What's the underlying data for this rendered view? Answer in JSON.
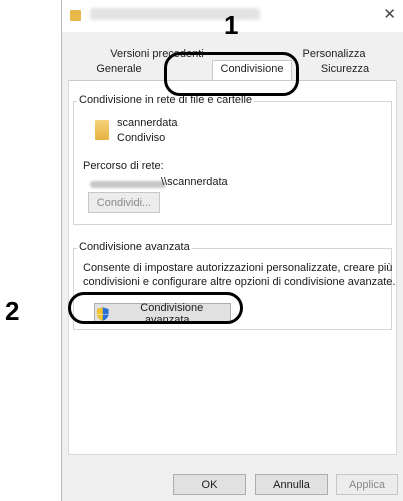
{
  "tabs": {
    "row1": [
      "Versioni precedenti",
      "Personalizza"
    ],
    "row2": [
      "Generale",
      "Condivisione",
      "Sicurezza"
    ]
  },
  "network_sharing": {
    "title": "Condivisione in rete di file e cartelle",
    "folder_name": "scannerdata",
    "status": "Condiviso",
    "path_label": "Percorso di rete:",
    "path_value": "\\\\scannerdata",
    "share_button": "Condividi..."
  },
  "advanced_sharing": {
    "title": "Condivisione avanzata",
    "description_line1": "Consente di impostare autorizzazioni personalizzate, creare più",
    "description_line2": "condivisioni e configurare altre opzioni di condivisione avanzate.",
    "button": "Condivisione avanzata..."
  },
  "footer": {
    "ok": "OK",
    "cancel": "Annulla",
    "apply": "Applica"
  },
  "callouts": {
    "step1": "1",
    "step2": "2"
  },
  "colors": {
    "ring": "#000000",
    "shield_blue": "#2c6fd1",
    "shield_yellow": "#f4c430"
  }
}
